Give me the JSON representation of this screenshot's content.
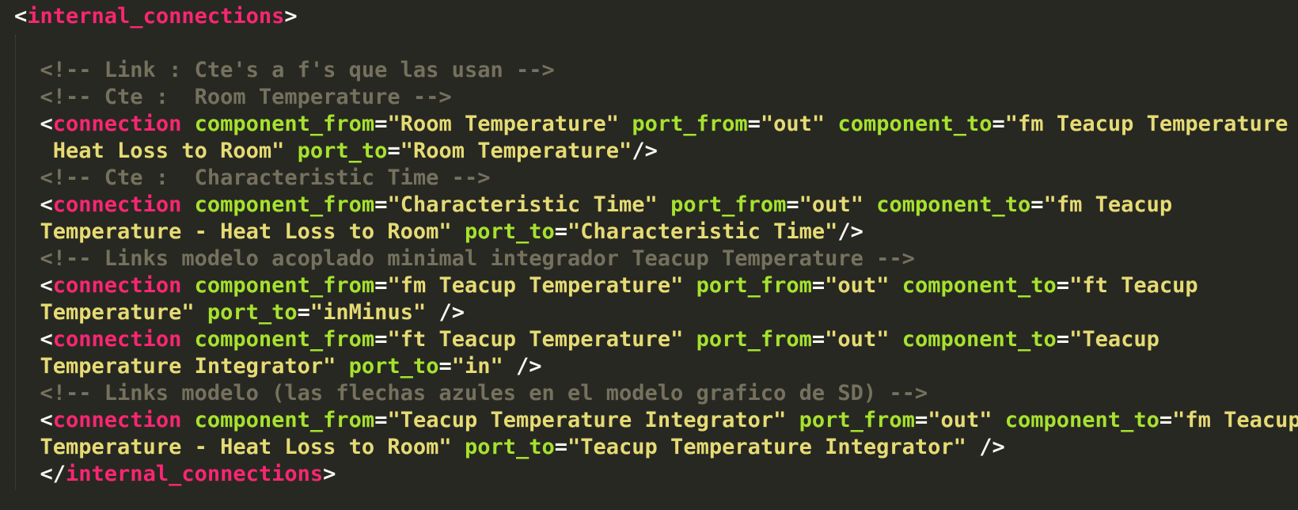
{
  "colors": {
    "background": "#272822",
    "text": "#f8f8f2",
    "comment": "#75715e",
    "tag": "#f92672",
    "attribute": "#a6e22e",
    "string": "#e6db74"
  },
  "lines": [
    [
      [
        "pun",
        "<"
      ],
      [
        "tag",
        "internal_connections"
      ],
      [
        "pun",
        ">"
      ]
    ],
    [],
    [
      [
        "cmt",
        "  <!-- Link : Cte's a f's que las usan -->"
      ]
    ],
    [
      [
        "cmt",
        "  <!-- Cte :  Room Temperature -->"
      ]
    ],
    [
      [
        "pun",
        "  <"
      ],
      [
        "tag",
        "connection"
      ],
      [
        "pun",
        " "
      ],
      [
        "attr",
        "component_from"
      ],
      [
        "pun",
        "="
      ],
      [
        "str",
        "\"Room Temperature\""
      ],
      [
        "pun",
        " "
      ],
      [
        "attr",
        "port_from"
      ],
      [
        "pun",
        "="
      ],
      [
        "str",
        "\"out\""
      ],
      [
        "pun",
        " "
      ],
      [
        "attr",
        "component_to"
      ],
      [
        "pun",
        "="
      ],
      [
        "str",
        "\"fm Teacup Temperature -"
      ]
    ],
    [
      [
        "str",
        "   Heat Loss to Room\""
      ],
      [
        "pun",
        " "
      ],
      [
        "attr",
        "port_to"
      ],
      [
        "pun",
        "="
      ],
      [
        "str",
        "\"Room Temperature\""
      ],
      [
        "pun",
        "/>"
      ]
    ],
    [
      [
        "cmt",
        "  <!-- Cte :  Characteristic Time -->"
      ]
    ],
    [
      [
        "pun",
        "  <"
      ],
      [
        "tag",
        "connection"
      ],
      [
        "pun",
        " "
      ],
      [
        "attr",
        "component_from"
      ],
      [
        "pun",
        "="
      ],
      [
        "str",
        "\"Characteristic Time\""
      ],
      [
        "pun",
        " "
      ],
      [
        "attr",
        "port_from"
      ],
      [
        "pun",
        "="
      ],
      [
        "str",
        "\"out\""
      ],
      [
        "pun",
        " "
      ],
      [
        "attr",
        "component_to"
      ],
      [
        "pun",
        "="
      ],
      [
        "str",
        "\"fm Teacup"
      ]
    ],
    [
      [
        "str",
        "  Temperature - Heat Loss to Room\""
      ],
      [
        "pun",
        " "
      ],
      [
        "attr",
        "port_to"
      ],
      [
        "pun",
        "="
      ],
      [
        "str",
        "\"Characteristic Time\""
      ],
      [
        "pun",
        "/>"
      ]
    ],
    [
      [
        "cmt",
        "  <!-- Links modelo acoplado minimal integrador Teacup Temperature -->"
      ]
    ],
    [
      [
        "pun",
        "  <"
      ],
      [
        "tag",
        "connection"
      ],
      [
        "pun",
        " "
      ],
      [
        "attr",
        "component_from"
      ],
      [
        "pun",
        "="
      ],
      [
        "str",
        "\"fm Teacup Temperature\""
      ],
      [
        "pun",
        " "
      ],
      [
        "attr",
        "port_from"
      ],
      [
        "pun",
        "="
      ],
      [
        "str",
        "\"out\""
      ],
      [
        "pun",
        " "
      ],
      [
        "attr",
        "component_to"
      ],
      [
        "pun",
        "="
      ],
      [
        "str",
        "\"ft Teacup"
      ]
    ],
    [
      [
        "str",
        "  Temperature\""
      ],
      [
        "pun",
        " "
      ],
      [
        "attr",
        "port_to"
      ],
      [
        "pun",
        "="
      ],
      [
        "str",
        "\"inMinus\""
      ],
      [
        "pun",
        " />"
      ]
    ],
    [
      [
        "pun",
        "  <"
      ],
      [
        "tag",
        "connection"
      ],
      [
        "pun",
        " "
      ],
      [
        "attr",
        "component_from"
      ],
      [
        "pun",
        "="
      ],
      [
        "str",
        "\"ft Teacup Temperature\""
      ],
      [
        "pun",
        " "
      ],
      [
        "attr",
        "port_from"
      ],
      [
        "pun",
        "="
      ],
      [
        "str",
        "\"out\""
      ],
      [
        "pun",
        " "
      ],
      [
        "attr",
        "component_to"
      ],
      [
        "pun",
        "="
      ],
      [
        "str",
        "\"Teacup"
      ]
    ],
    [
      [
        "str",
        "  Temperature Integrator\""
      ],
      [
        "pun",
        " "
      ],
      [
        "attr",
        "port_to"
      ],
      [
        "pun",
        "="
      ],
      [
        "str",
        "\"in\""
      ],
      [
        "pun",
        " />"
      ]
    ],
    [
      [
        "cmt",
        "  <!-- Links modelo (las flechas azules en el modelo grafico de SD) -->"
      ]
    ],
    [
      [
        "pun",
        "  <"
      ],
      [
        "tag",
        "connection"
      ],
      [
        "pun",
        " "
      ],
      [
        "attr",
        "component_from"
      ],
      [
        "pun",
        "="
      ],
      [
        "str",
        "\"Teacup Temperature Integrator\""
      ],
      [
        "pun",
        " "
      ],
      [
        "attr",
        "port_from"
      ],
      [
        "pun",
        "="
      ],
      [
        "str",
        "\"out\""
      ],
      [
        "pun",
        " "
      ],
      [
        "attr",
        "component_to"
      ],
      [
        "pun",
        "="
      ],
      [
        "str",
        "\"fm Teacup"
      ]
    ],
    [
      [
        "str",
        "  Temperature - Heat Loss to Room\""
      ],
      [
        "pun",
        " "
      ],
      [
        "attr",
        "port_to"
      ],
      [
        "pun",
        "="
      ],
      [
        "str",
        "\"Teacup Temperature Integrator\""
      ],
      [
        "pun",
        " />"
      ]
    ],
    [
      [
        "pun",
        "  </"
      ],
      [
        "tag",
        "internal_connections"
      ],
      [
        "pun",
        ">"
      ]
    ]
  ]
}
